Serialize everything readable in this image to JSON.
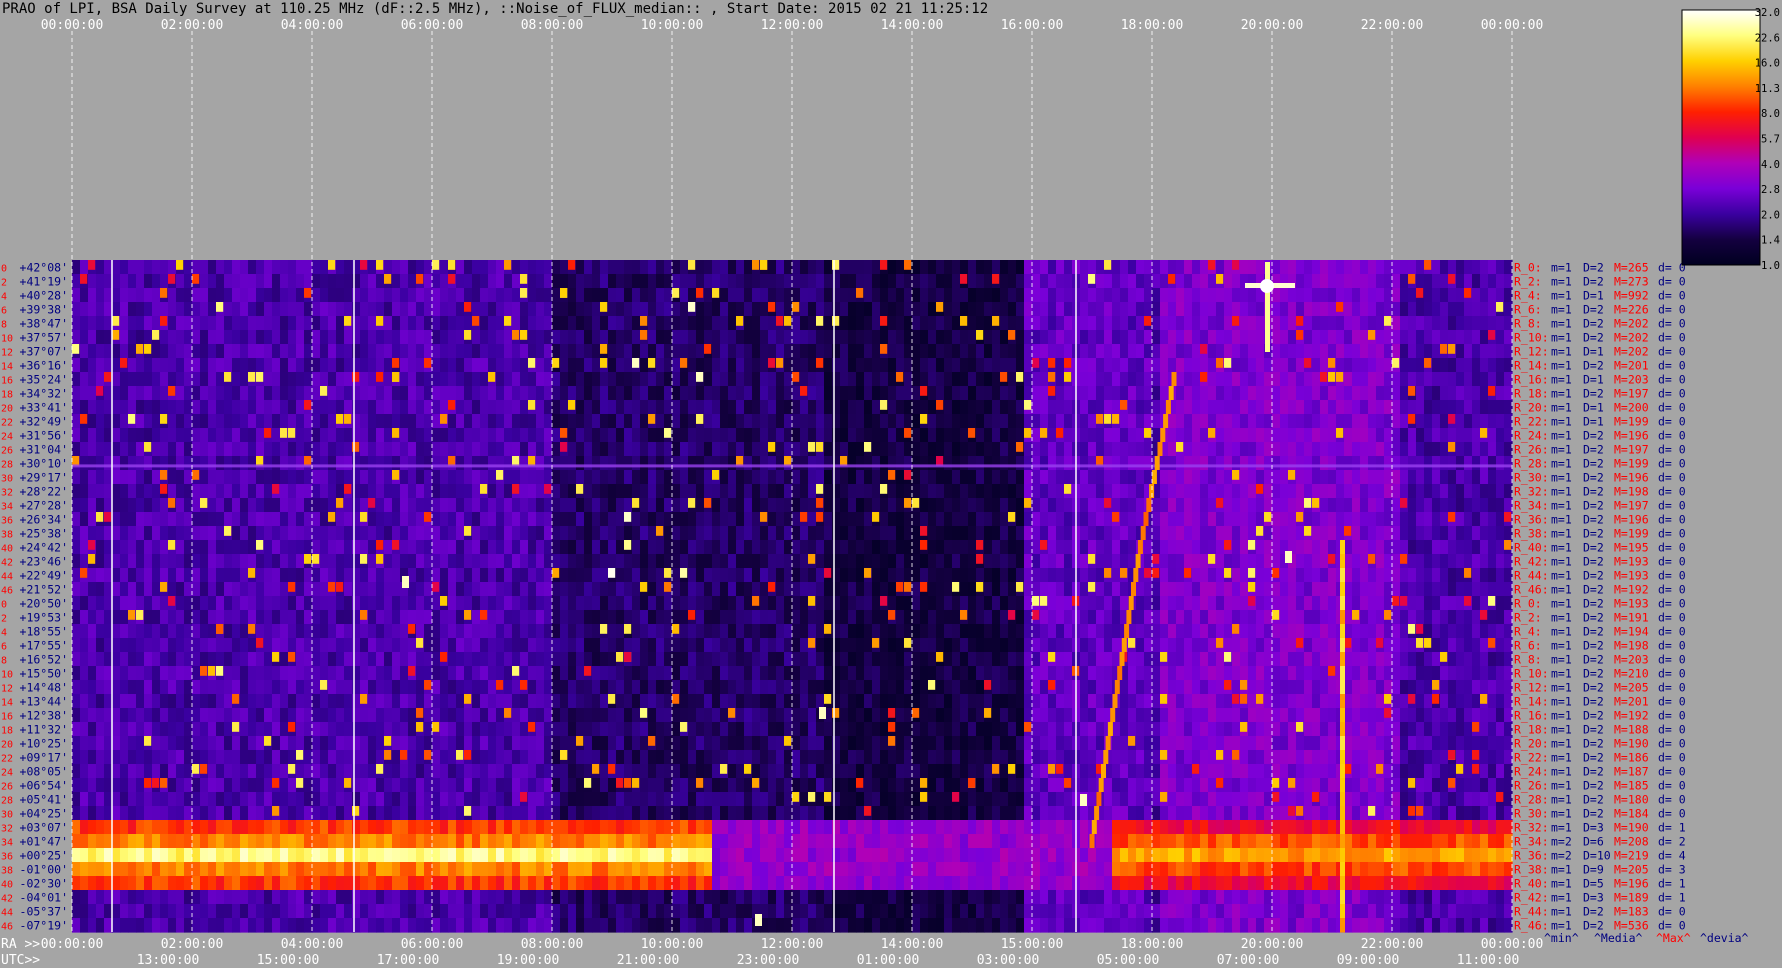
{
  "title": "PRAO of LPI, BSA Daily Survey at 110.25 MHz (dF::2.5 MHz), ::Noise_of_FLUX_median:: , Start Date: 2015 02 21 11:25:12",
  "colors": {
    "background": "#a5a5a5",
    "label_red": "#ff0000",
    "label_blue": "#000080",
    "grid": "#ffffff"
  },
  "chart_data": {
    "type": "heatmap",
    "top_time_ticks": [
      "00:00:00",
      "02:00:00",
      "04:00:00",
      "06:00:00",
      "08:00:00",
      "10:00:00",
      "12:00:00",
      "14:00:00",
      "16:00:00",
      "18:00:00",
      "20:00:00",
      "22:00:00",
      "00:00:00"
    ],
    "ra_prefix": "RA >>",
    "ra_ticks": [
      "00:00:00",
      "02:00:00",
      "04:00:00",
      "06:00:00",
      "08:00:00",
      "10:00:00",
      "12:00:00",
      "14:00:00",
      "15:00:00",
      "18:00:00",
      "20:00:00",
      "22:00:00",
      "00:00:00"
    ],
    "utc_prefix": "UTC>>",
    "utc_ticks": [
      "13:00:00",
      "15:00:00",
      "17:00:00",
      "19:00:00",
      "21:00:00",
      "23:00:00",
      "01:00:00",
      "03:00:00",
      "05:00:00",
      "07:00:00",
      "09:00:00",
      "11:00:00"
    ],
    "ray_numbers": [
      "0",
      "2",
      "4",
      "6",
      "8",
      "10",
      "12",
      "14",
      "16",
      "18",
      "20",
      "22",
      "24",
      "26",
      "28",
      "30",
      "32",
      "34",
      "36",
      "38",
      "40",
      "42",
      "44",
      "46",
      "0",
      "2",
      "4",
      "6",
      "8",
      "10",
      "12",
      "14",
      "16",
      "18",
      "20",
      "22",
      "24",
      "26",
      "28",
      "30",
      "32",
      "34",
      "36",
      "38",
      "40",
      "42",
      "44",
      "46"
    ],
    "declinations": [
      "+42°08'",
      "+41°19'",
      "+40°28'",
      "+39°38'",
      "+38°47'",
      "+37°57'",
      "+37°07'",
      "+36°16'",
      "+35°24'",
      "+34°32'",
      "+33°41'",
      "+32°49'",
      "+31°56'",
      "+31°04'",
      "+30°10'",
      "+29°17'",
      "+28°22'",
      "+27°28'",
      "+26°34'",
      "+25°38'",
      "+24°42'",
      "+23°46'",
      "+22°49'",
      "+21°52'",
      "+20°50'",
      "+19°53'",
      "+18°55'",
      "+17°55'",
      "+16°52'",
      "+15°50'",
      "+14°48'",
      "+13°44'",
      "+12°38'",
      "+11°32'",
      "+10°25'",
      "+09°17'",
      "+08°05'",
      "+06°54'",
      "+05°41'",
      "+04°25'",
      "+03°07'",
      "+01°47'",
      "+00°25'",
      "-01°00'",
      "-02°30'",
      "-04°01'",
      "-05°37'",
      "-07°19'"
    ],
    "stats_rows": [
      {
        "ray": "R_0:",
        "m": "m=1",
        "d": "D=2",
        "mx": "M=265",
        "dev": "d= 0"
      },
      {
        "ray": "R_2:",
        "m": "m=1",
        "d": "D=2",
        "mx": "M=273",
        "dev": "d= 0"
      },
      {
        "ray": "R_4:",
        "m": "m=1",
        "d": "D=1",
        "mx": "M=992",
        "dev": "d= 0"
      },
      {
        "ray": "R_6:",
        "m": "m=1",
        "d": "D=2",
        "mx": "M=226",
        "dev": "d= 0"
      },
      {
        "ray": "R_8:",
        "m": "m=1",
        "d": "D=2",
        "mx": "M=202",
        "dev": "d= 0"
      },
      {
        "ray": "R_10:",
        "m": "m=1",
        "d": "D=2",
        "mx": "M=202",
        "dev": "d= 0"
      },
      {
        "ray": "R_12:",
        "m": "m=1",
        "d": "D=1",
        "mx": "M=202",
        "dev": "d= 0"
      },
      {
        "ray": "R_14:",
        "m": "m=1",
        "d": "D=2",
        "mx": "M=201",
        "dev": "d= 0"
      },
      {
        "ray": "R_16:",
        "m": "m=1",
        "d": "D=1",
        "mx": "M=203",
        "dev": "d= 0"
      },
      {
        "ray": "R_18:",
        "m": "m=1",
        "d": "D=2",
        "mx": "M=197",
        "dev": "d= 0"
      },
      {
        "ray": "R_20:",
        "m": "m=1",
        "d": "D=1",
        "mx": "M=200",
        "dev": "d= 0"
      },
      {
        "ray": "R_22:",
        "m": "m=1",
        "d": "D=1",
        "mx": "M=199",
        "dev": "d= 0"
      },
      {
        "ray": "R_24:",
        "m": "m=1",
        "d": "D=2",
        "mx": "M=196",
        "dev": "d= 0"
      },
      {
        "ray": "R_26:",
        "m": "m=1",
        "d": "D=2",
        "mx": "M=197",
        "dev": "d= 0"
      },
      {
        "ray": "R_28:",
        "m": "m=1",
        "d": "D=2",
        "mx": "M=199",
        "dev": "d= 0"
      },
      {
        "ray": "R_30:",
        "m": "m=1",
        "d": "D=2",
        "mx": "M=196",
        "dev": "d= 0"
      },
      {
        "ray": "R_32:",
        "m": "m=1",
        "d": "D=2",
        "mx": "M=198",
        "dev": "d= 0"
      },
      {
        "ray": "R_34:",
        "m": "m=1",
        "d": "D=2",
        "mx": "M=197",
        "dev": "d= 0"
      },
      {
        "ray": "R_36:",
        "m": "m=1",
        "d": "D=2",
        "mx": "M=196",
        "dev": "d= 0"
      },
      {
        "ray": "R_38:",
        "m": "m=1",
        "d": "D=2",
        "mx": "M=199",
        "dev": "d= 0"
      },
      {
        "ray": "R_40:",
        "m": "m=1",
        "d": "D=2",
        "mx": "M=195",
        "dev": "d= 0"
      },
      {
        "ray": "R_42:",
        "m": "m=1",
        "d": "D=2",
        "mx": "M=193",
        "dev": "d= 0"
      },
      {
        "ray": "R_44:",
        "m": "m=1",
        "d": "D=2",
        "mx": "M=193",
        "dev": "d= 0"
      },
      {
        "ray": "R_46:",
        "m": "m=1",
        "d": "D=2",
        "mx": "M=192",
        "dev": "d= 0"
      },
      {
        "ray": "R_0:",
        "m": "m=1",
        "d": "D=2",
        "mx": "M=193",
        "dev": "d= 0"
      },
      {
        "ray": "R_2:",
        "m": "m=1",
        "d": "D=2",
        "mx": "M=191",
        "dev": "d= 0"
      },
      {
        "ray": "R_4:",
        "m": "m=1",
        "d": "D=2",
        "mx": "M=194",
        "dev": "d= 0"
      },
      {
        "ray": "R_6:",
        "m": "m=1",
        "d": "D=2",
        "mx": "M=198",
        "dev": "d= 0"
      },
      {
        "ray": "R_8:",
        "m": "m=1",
        "d": "D=2",
        "mx": "M=203",
        "dev": "d= 0"
      },
      {
        "ray": "R_10:",
        "m": "m=1",
        "d": "D=2",
        "mx": "M=210",
        "dev": "d= 0"
      },
      {
        "ray": "R_12:",
        "m": "m=1",
        "d": "D=2",
        "mx": "M=205",
        "dev": "d= 0"
      },
      {
        "ray": "R_14:",
        "m": "m=1",
        "d": "D=2",
        "mx": "M=201",
        "dev": "d= 0"
      },
      {
        "ray": "R_16:",
        "m": "m=1",
        "d": "D=2",
        "mx": "M=192",
        "dev": "d= 0"
      },
      {
        "ray": "R_18:",
        "m": "m=1",
        "d": "D=2",
        "mx": "M=188",
        "dev": "d= 0"
      },
      {
        "ray": "R_20:",
        "m": "m=1",
        "d": "D=2",
        "mx": "M=190",
        "dev": "d= 0"
      },
      {
        "ray": "R_22:",
        "m": "m=1",
        "d": "D=2",
        "mx": "M=186",
        "dev": "d= 0"
      },
      {
        "ray": "R_24:",
        "m": "m=1",
        "d": "D=2",
        "mx": "M=187",
        "dev": "d= 0"
      },
      {
        "ray": "R_26:",
        "m": "m=1",
        "d": "D=2",
        "mx": "M=185",
        "dev": "d= 0"
      },
      {
        "ray": "R_28:",
        "m": "m=1",
        "d": "D=2",
        "mx": "M=180",
        "dev": "d= 0"
      },
      {
        "ray": "R_30:",
        "m": "m=1",
        "d": "D=2",
        "mx": "M=184",
        "dev": "d= 0"
      },
      {
        "ray": "R_32:",
        "m": "m=1",
        "d": "D=3",
        "mx": "M=190",
        "dev": "d= 1"
      },
      {
        "ray": "R_34:",
        "m": "m=2",
        "d": "D=6",
        "mx": "M=208",
        "dev": "d= 2"
      },
      {
        "ray": "R_36:",
        "m": "m=2",
        "d": "D=10",
        "mx": "M=219",
        "dev": "d= 4"
      },
      {
        "ray": "R_38:",
        "m": "m=1",
        "d": "D=9",
        "mx": "M=205",
        "dev": "d= 3"
      },
      {
        "ray": "R_40:",
        "m": "m=1",
        "d": "D=5",
        "mx": "M=196",
        "dev": "d= 1"
      },
      {
        "ray": "R_42:",
        "m": "m=1",
        "d": "D=3",
        "mx": "M=189",
        "dev": "d= 1"
      },
      {
        "ray": "R_44:",
        "m": "m=1",
        "d": "D=2",
        "mx": "M=183",
        "dev": "d= 0"
      },
      {
        "ray": "R_46:",
        "m": "m=1",
        "d": "D=2",
        "mx": "M=536",
        "dev": "d= 0"
      }
    ],
    "stats_footer": {
      "min": "^min^",
      "median": "^Media^",
      "max": "^Max^",
      "dev": "^devia^"
    },
    "colorbar": {
      "labels": [
        "32.0",
        "22.6",
        "16.0",
        "11.3",
        "8.0",
        "5.7",
        "4.0",
        "2.8",
        "2.0",
        "1.4",
        "1.0"
      ],
      "min": 1.0,
      "max": 32.0,
      "scale": "log"
    }
  }
}
